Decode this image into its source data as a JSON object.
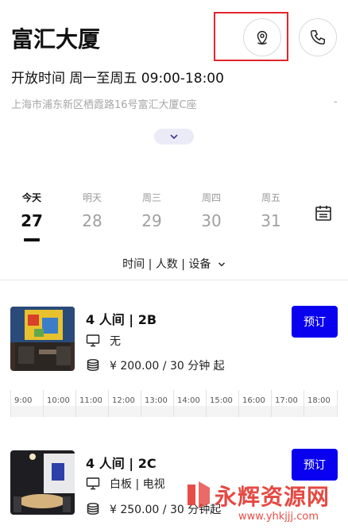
{
  "building": {
    "name": "富汇大厦",
    "hours": "开放时间 周一至周五 09:00-18:00",
    "address": "上海市浦东新区栖霞路16号富汇大厦C座",
    "address_trail": "-"
  },
  "icons": {
    "location": "map-pin-icon",
    "phone": "phone-icon",
    "expand": "chevron-down-icon",
    "calendar": "calendar-icon",
    "screen": "monitor-icon",
    "price": "coin-stack-icon"
  },
  "colors": {
    "accent": "#0a00f0",
    "highlight": "#e0262c",
    "expand_bg": "#ebebf8",
    "watermark": "#e33a32"
  },
  "days": [
    {
      "weekday": "今天",
      "date": "27",
      "active": true
    },
    {
      "weekday": "明天",
      "date": "28",
      "active": false
    },
    {
      "weekday": "周三",
      "date": "29",
      "active": false
    },
    {
      "weekday": "周四",
      "date": "30",
      "active": false
    },
    {
      "weekday": "周五",
      "date": "31",
      "active": false
    }
  ],
  "filters_label": "时间 | 人数 | 设备",
  "rooms": [
    {
      "name": "4 人间 | 2B",
      "equipment": "无",
      "price": "¥ 200.00 / 30 分钟 起",
      "book_label": "预订"
    },
    {
      "name": "4 人间 | 2C",
      "equipment": "白板 | 电视",
      "price": "¥ 250.00 / 30 分钟起",
      "book_label": "预订"
    }
  ],
  "timeline": [
    "9:00",
    "10:00",
    "11:00",
    "12:00",
    "13:00",
    "14:00",
    "15:00",
    "16:00",
    "17:00",
    "18:00"
  ],
  "watermark": {
    "text": "永辉资源网",
    "url": "www.yhkjjj.com"
  }
}
